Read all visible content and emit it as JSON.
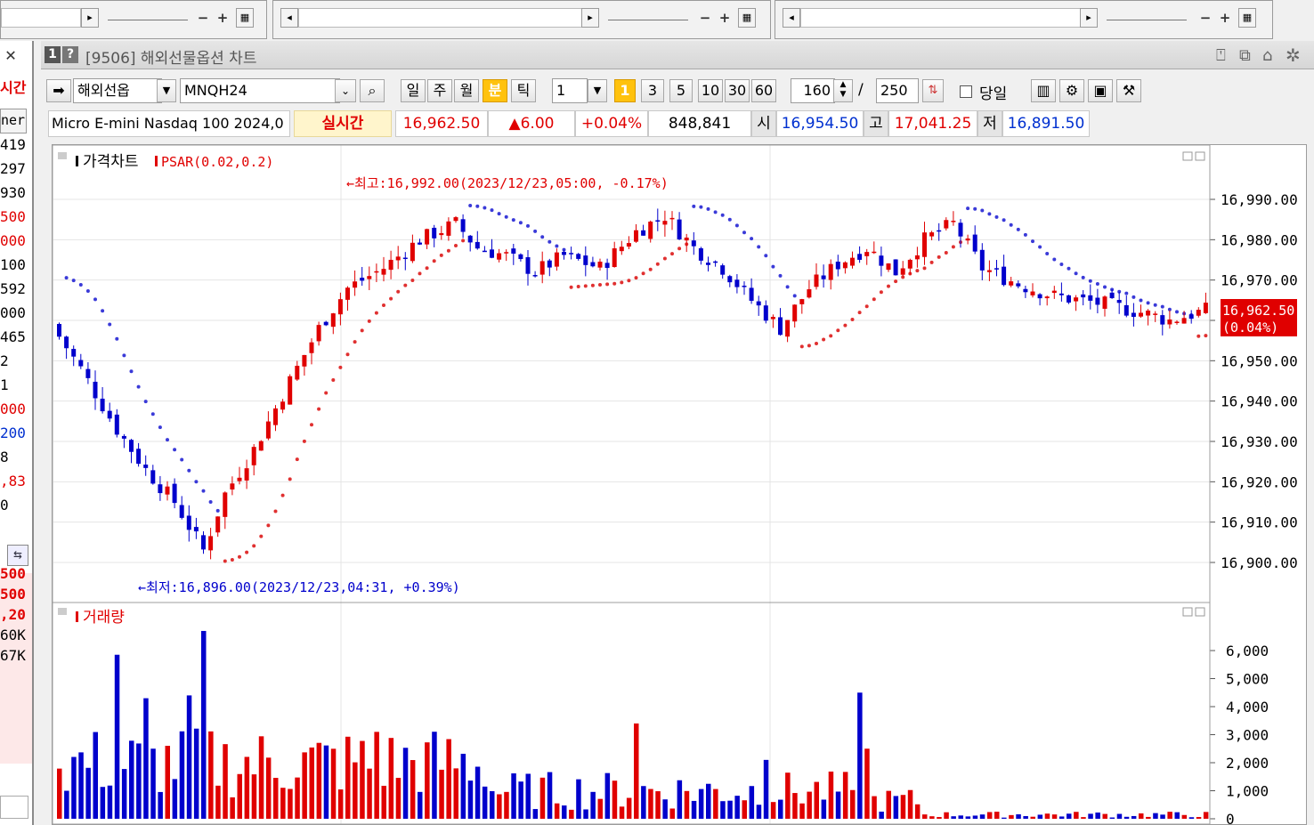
{
  "mini_windows": [
    {
      "zoom_minus": "−",
      "zoom_plus": "+"
    },
    {
      "zoom_minus": "−",
      "zoom_plus": "+"
    },
    {
      "zoom_minus": "−",
      "zoom_plus": "+"
    }
  ],
  "left_panel": {
    "close": "✕",
    "header": "시간",
    "tab": "ner",
    "rows": [
      {
        "text": "419",
        "color": "#000000"
      },
      {
        "text": "297",
        "color": "#000000"
      },
      {
        "text": "930",
        "color": "#000000"
      },
      {
        "text": "500",
        "color": "#e00000"
      },
      {
        "text": "000",
        "color": "#e00000"
      },
      {
        "text": "100",
        "color": "#000000"
      },
      {
        "text": "592",
        "color": "#000000"
      },
      {
        "text": "000",
        "color": "#000000"
      },
      {
        "text": "465",
        "color": "#000000"
      },
      {
        "text": "2",
        "color": "#000000"
      },
      {
        "text": "1",
        "color": "#000000"
      },
      {
        "text": "000",
        "color": "#e00000"
      },
      {
        "text": "200",
        "color": "#0030d0"
      },
      {
        "text": "8",
        "color": "#000000"
      },
      {
        "text": ",83",
        "color": "#e00000"
      },
      {
        "text": "0",
        "color": "#000000"
      }
    ],
    "rows2": [
      {
        "text": "500",
        "color": "#e00000"
      },
      {
        "text": "500",
        "color": "#e00000"
      },
      {
        "text": ",20",
        "color": "#e00000"
      },
      {
        "text": "60K",
        "color": "#000000"
      },
      {
        "text": "67K",
        "color": "#000000"
      }
    ]
  },
  "window": {
    "num_badge": "1",
    "help_badge": "?",
    "title": "[9506] 해외선물옵션 차트"
  },
  "toolbar": {
    "market": "해외선옵",
    "symbol": "MNQH24",
    "periods": [
      "일",
      "주",
      "월",
      "분",
      "틱"
    ],
    "active_period": "분",
    "interval_value": "1",
    "intervals": [
      "1",
      "3",
      "5",
      "10",
      "30",
      "60"
    ],
    "active_interval": "1",
    "display_count": "160",
    "separator": "/",
    "total_count": "250",
    "today_label": "당일"
  },
  "quote": {
    "name": "Micro E-mini Nasdaq 100 2024,0",
    "realtime": "실시간",
    "price": "16,962.50",
    "change": "▲6.00",
    "change_pct": "+0.04%",
    "volume": "848,841",
    "open_label": "시",
    "open": "16,954.50",
    "high_label": "고",
    "high": "17,041.25",
    "low_label": "저",
    "low": "16,891.50"
  },
  "price_panel": {
    "title": "가격차트",
    "indicator": "PSAR(0.02,0.2)",
    "high_annotation": "←최고:16,992.00(2023/12/23,05:00, -0.17%)",
    "low_annotation": "←최저:16,896.00(2023/12/23,04:31, +0.39%)",
    "current_price_tag": "16,962.50",
    "current_pct_tag": "(0.04%)"
  },
  "volume_panel": {
    "title": "거래량"
  },
  "colors": {
    "up": "#e00000",
    "down": "#0000cc",
    "psar_up": "#e03030",
    "psar_down": "#3a3ad8",
    "grid": "#e4e4e4",
    "tag_bg": "#e00000"
  },
  "chart_data": [
    {
      "type": "candlestick",
      "title": "가격차트",
      "y_ticks": [
        "16,900.00",
        "16,910.00",
        "16,920.00",
        "16,930.00",
        "16,940.00",
        "16,950.00",
        "16,960.00",
        "16,970.00",
        "16,980.00",
        "16,990.00"
      ],
      "ylim": [
        16896,
        16992
      ],
      "series": [
        {
          "name": "PSAR(0.02,0.2)"
        }
      ],
      "high": 16992.0,
      "low": 16896.0,
      "last": 16962.5
    },
    {
      "type": "bar",
      "title": "거래량",
      "y_ticks": [
        "0",
        "1,000",
        "2,000",
        "3,000",
        "4,000",
        "5,000",
        "6,000"
      ],
      "ylim": [
        0,
        6000
      ]
    }
  ]
}
